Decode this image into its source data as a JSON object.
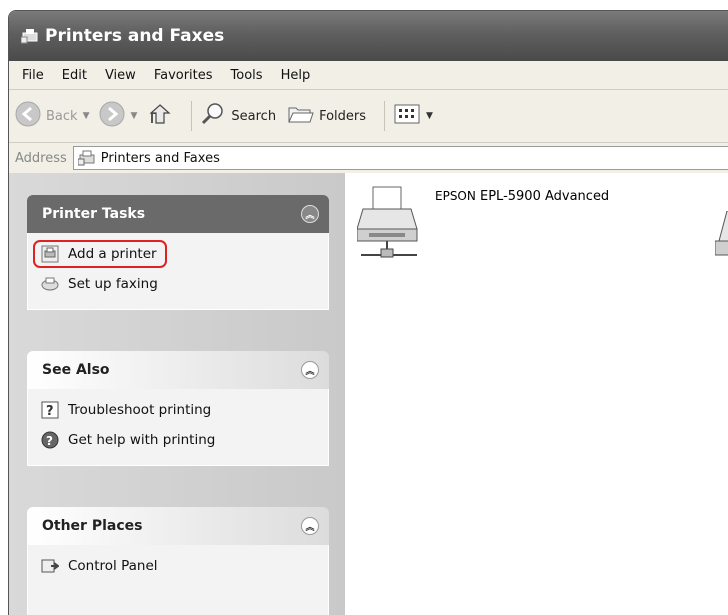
{
  "window": {
    "title": "Printers and Faxes"
  },
  "menu": [
    "File",
    "Edit",
    "View",
    "Favorites",
    "Tools",
    "Help"
  ],
  "toolbar": {
    "back": "Back",
    "search": "Search",
    "folders": "Folders"
  },
  "address": {
    "label": "Address",
    "value": "Printers and Faxes"
  },
  "panels": {
    "printer_tasks": {
      "title": "Printer Tasks",
      "items": [
        "Add a printer",
        "Set up faxing"
      ]
    },
    "see_also": {
      "title": "See Also",
      "items": [
        "Troubleshoot printing",
        "Get help with printing"
      ]
    },
    "other_places": {
      "title": "Other Places",
      "items": [
        "Control Panel"
      ]
    }
  },
  "printers": [
    {
      "brand": "EPSON",
      "model": "EPL-5900 Advanced"
    }
  ]
}
